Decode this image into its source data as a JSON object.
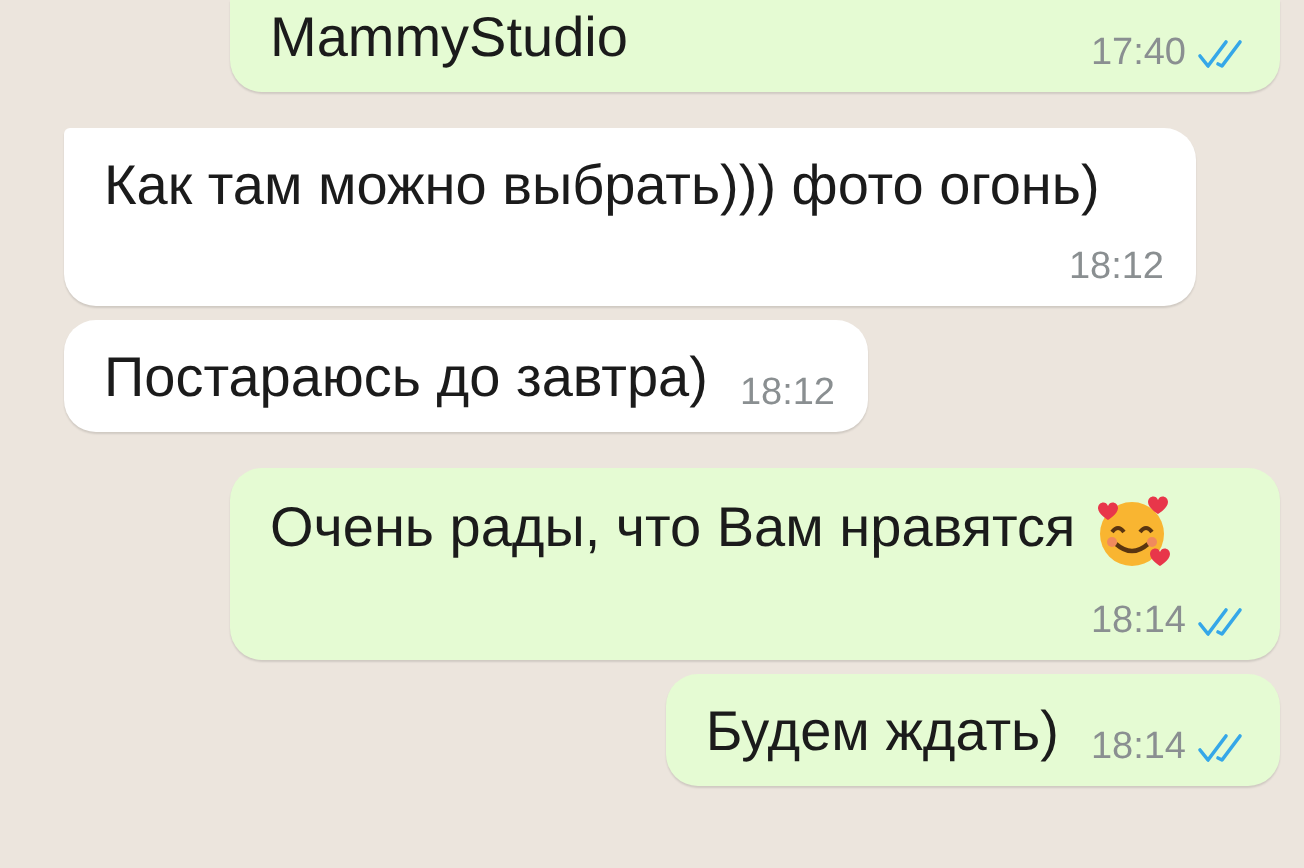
{
  "messages": [
    {
      "kind": "outgoing",
      "text": "MammyStudio",
      "time": "17:40",
      "read": true,
      "emoji": false,
      "tail": false
    },
    {
      "kind": "incoming",
      "text": "Как там можно выбрать))) фото огонь)",
      "time": "18:12",
      "emoji": false,
      "tail": true
    },
    {
      "kind": "incoming",
      "text": "Постараюсь до завтра)",
      "time": "18:12",
      "emoji": false,
      "tail": false
    },
    {
      "kind": "outgoing",
      "text": "Очень рады, что Вам нравятся",
      "time": "18:14",
      "read": true,
      "emoji": true,
      "tail": false
    },
    {
      "kind": "outgoing",
      "text": "Будем ждать)",
      "time": "18:14",
      "read": true,
      "emoji": false,
      "tail": false
    }
  ]
}
